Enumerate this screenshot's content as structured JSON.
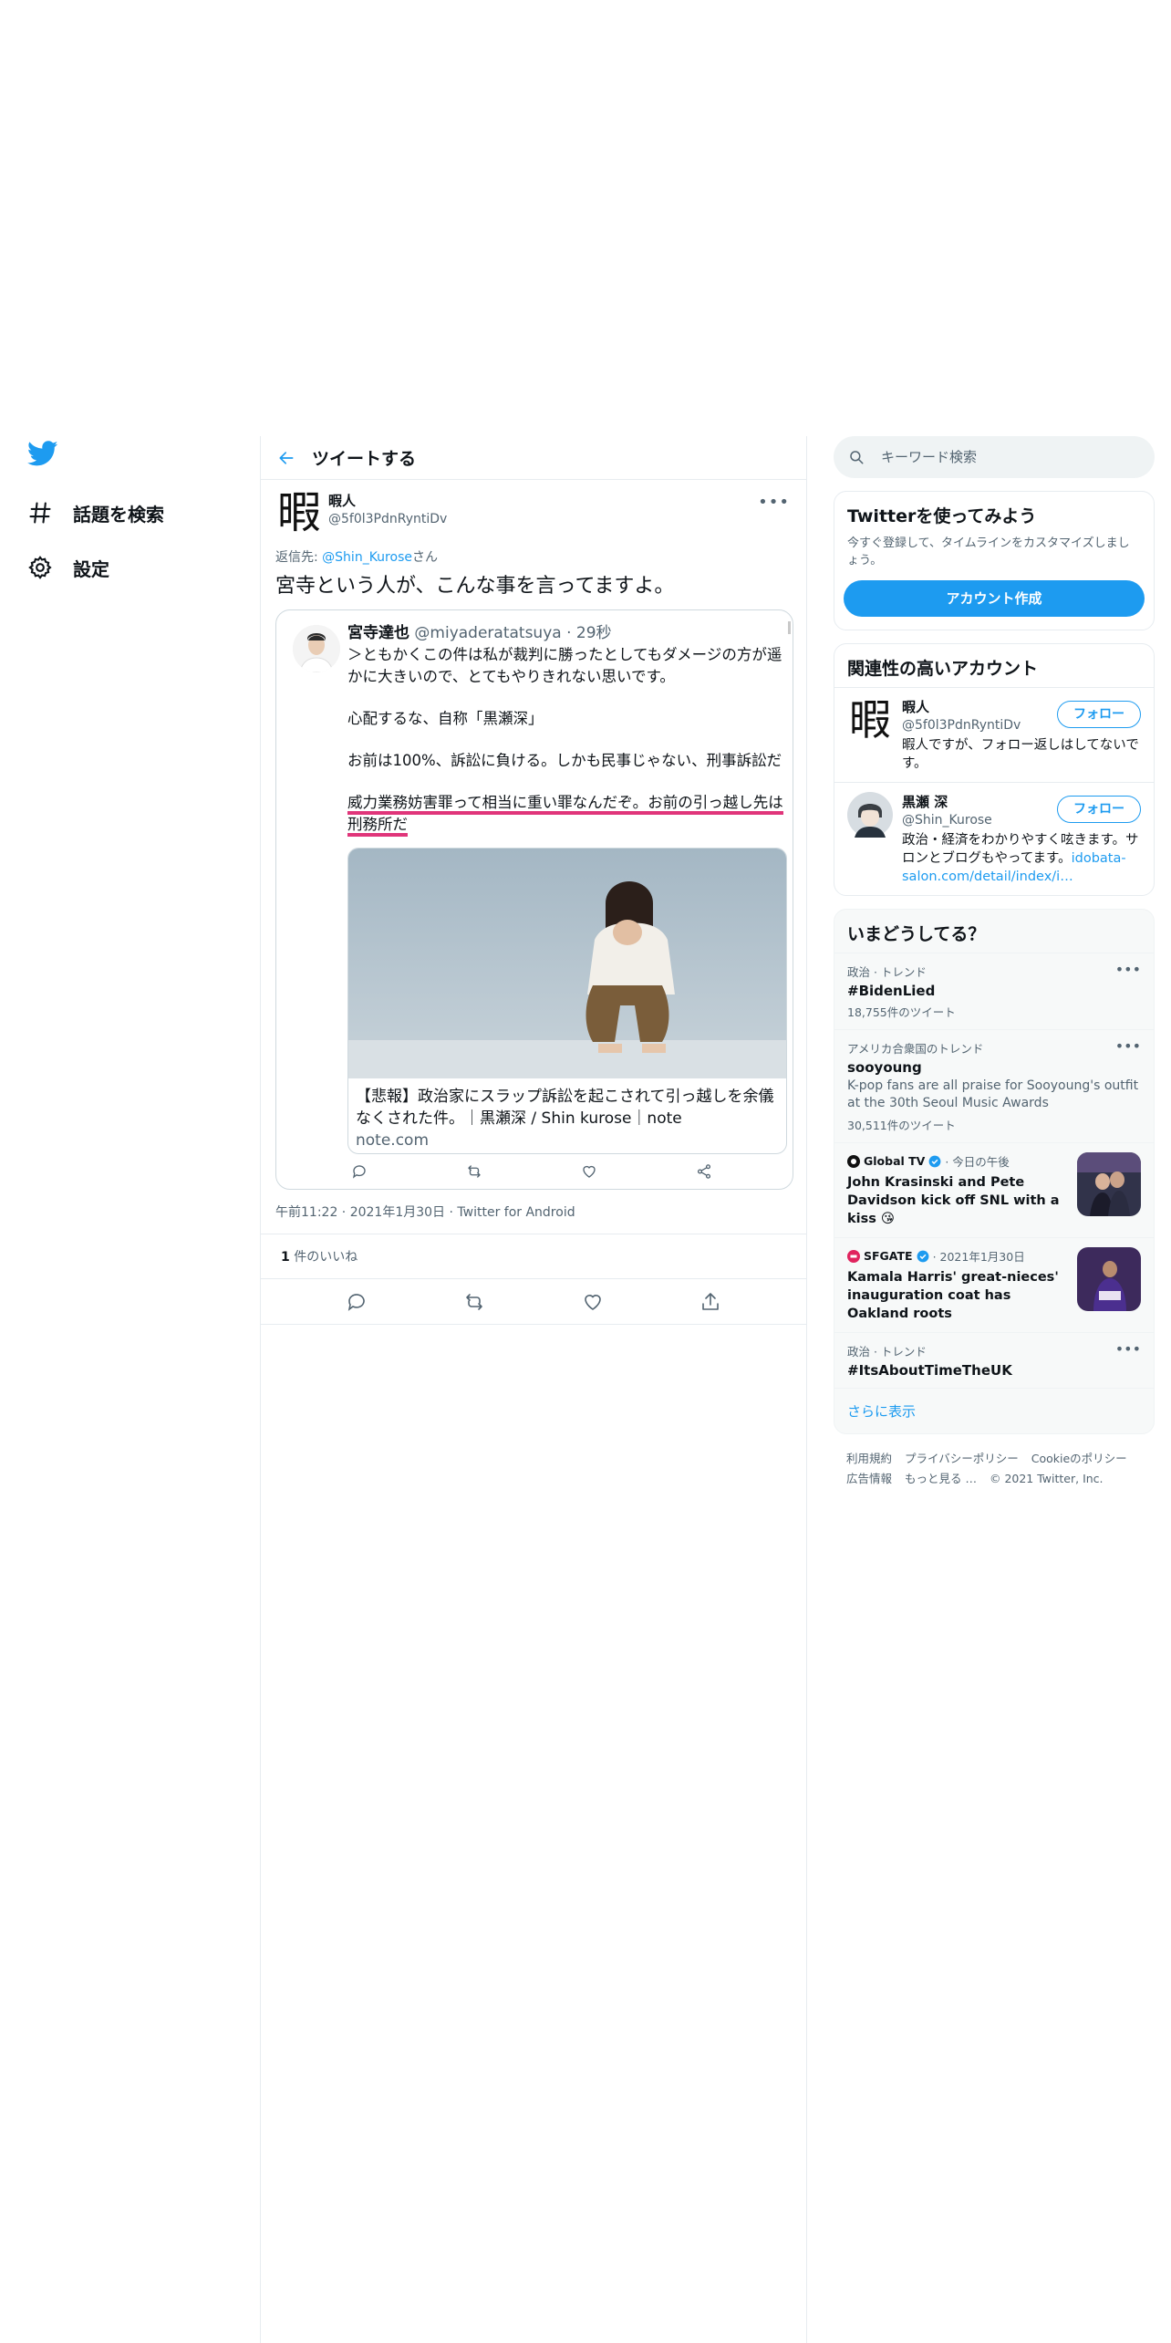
{
  "sidebar": {
    "logo": "twitter-bird-icon",
    "items": [
      {
        "icon": "hashtag-icon",
        "label": "話題を検索"
      },
      {
        "icon": "gear-icon",
        "label": "設定"
      }
    ]
  },
  "header": {
    "title": "ツイートする"
  },
  "tweet": {
    "author_avatar_text": "暇",
    "author_name": "暇人",
    "author_handle": "@5f0l3PdnRyntiDv",
    "reply_prefix": "返信先: ",
    "reply_mention": "@Shin_Kurose",
    "reply_suffix": "さん",
    "text": "宮寺という人が、こんな事を言ってますよ。",
    "embed": {
      "name": "宮寺達也",
      "handle": "@miyaderatatsuya · 29秒",
      "line1": "＞ともかくこの件は私が裁判に勝ったとしてもダメージの方が遥かに大きいので、とてもやりきれない思いです。",
      "line2": "心配するな、自称「黒瀬深」",
      "line3": "お前は100%、訴訟に負ける。しかも民事じゃない、刑事訴訟だ",
      "line4a": "威力業務妨害罪って相当に重い罪なんだぞ。",
      "line4b": "お前の引っ越し先は刑務所だ",
      "card_title": "【悲報】政治家にスラップ訴訟を起こされて引っ越しを余儀なくされた件。｜黒瀬深 / Shin kurose｜note",
      "card_domain": "note.com"
    },
    "meta": "午前11:22 · 2021年1月30日 · Twitter for Android",
    "likes_count": "1",
    "likes_label": " 件のいいね"
  },
  "search": {
    "placeholder": "キーワード検索"
  },
  "signup": {
    "title": "Twitterを使ってみよう",
    "desc": "今すぐ登録して、タイムラインをカスタマイズしましょう。",
    "button": "アカウント作成"
  },
  "related": {
    "title": "関連性の高いアカウント",
    "accounts": [
      {
        "avatar_text": "暇",
        "name": "暇人",
        "handle": "@5f0l3PdnRyntiDv",
        "bio": "暇人ですが、フォロー返しはしてないです。",
        "follow": "フォロー"
      },
      {
        "name": "黒瀬 深",
        "handle": "@Shin_Kurose",
        "bio": "政治・経済をわかりやすく呟きます。サロンとブログもやってます。",
        "bio_link": "idobata-salon.com/detail/index/i…",
        "follow": "フォロー"
      }
    ]
  },
  "trends": {
    "title": "いまどうしてる？",
    "items": [
      {
        "category": "政治 · トレンド",
        "name": "#BidenLied",
        "count": "18,755件のツイート"
      },
      {
        "category": "アメリカ合衆国のトレンド",
        "name": "sooyoung",
        "desc": "K-pop fans are all praise for Sooyoung's outfit at the 30th Seoul Music Awards",
        "count": "30,511件のツイート"
      },
      {
        "category": "政治 · トレンド",
        "name": "#ItsAboutTimeTheUK"
      }
    ],
    "news": [
      {
        "source": "Global TV",
        "time": " · 今日の午後",
        "title": "John Krasinski and Pete Davidson kick off SNL with a kiss 😘"
      },
      {
        "source": "SFGATE",
        "time": " · 2021年1月30日",
        "title": "Kamala Harris' great-nieces' inauguration coat has Oakland roots"
      }
    ],
    "show_more": "さらに表示"
  },
  "footer": {
    "links": [
      "利用規約",
      "プライバシーポリシー",
      "Cookieのポリシー",
      "広告情報",
      "もっと見る …",
      "© 2021 Twitter, Inc."
    ]
  },
  "colors": {
    "accent": "#1d9bf0",
    "highlight": "#e0357a",
    "text": "#0f1419",
    "muted": "#536471"
  }
}
